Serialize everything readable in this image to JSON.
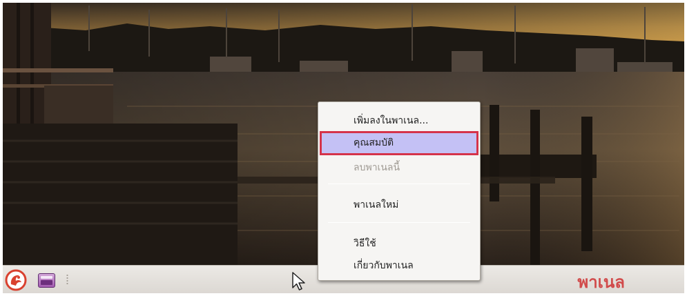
{
  "wallpaper": {
    "description_icon": "harbor-sunset-wallpaper"
  },
  "context_menu": {
    "items": [
      {
        "label": "เพิ่มลงในพาเนล...",
        "state": "normal"
      },
      {
        "label": "คุณสมบัติ",
        "state": "selected"
      },
      {
        "label": "ลบพาเนลนี้",
        "state": "disabled"
      },
      {
        "label": "พาเนลใหม่",
        "state": "normal"
      },
      {
        "label": "วิธีใช้",
        "state": "normal"
      },
      {
        "label": "เกี่ยวกับพาเนล",
        "state": "normal"
      }
    ]
  },
  "panel": {
    "label": "พาเนล",
    "icons": [
      "main-menu-icon",
      "show-desktop-icon",
      "panel-grip-icon",
      "mouse-pointer-icon"
    ]
  },
  "colors": {
    "selection_bg": "#c4c1f5",
    "selection_outline": "#d5334a",
    "panel_label": "#d14b4b"
  }
}
